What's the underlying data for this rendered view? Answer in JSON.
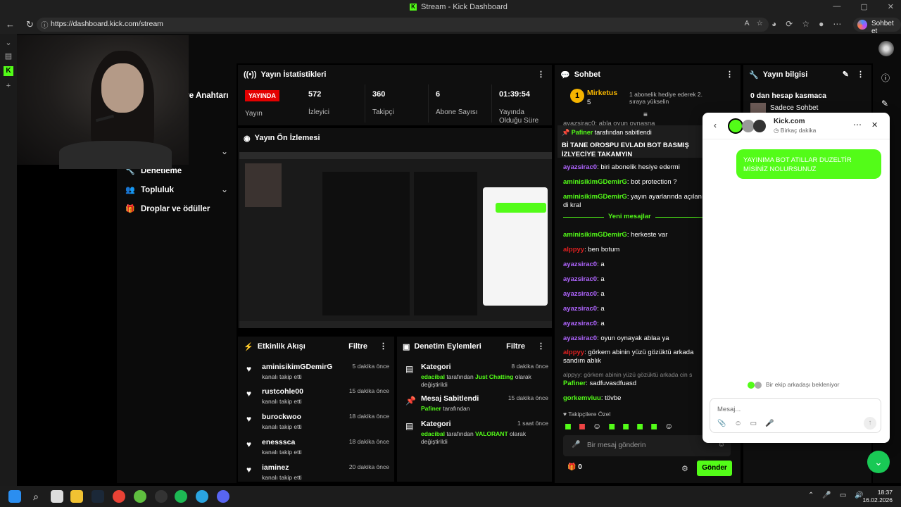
{
  "browser": {
    "title": "Stream - Kick Dashboard",
    "url": "https://dashboard.kick.com/stream",
    "copilot_label": "Sohbet et"
  },
  "nav": {
    "partial_label": "ı ve Anahtarı",
    "moderation": "Denetleme",
    "community": "Topluluk",
    "drops": "Droplar ve ödüller"
  },
  "stats": {
    "header": "Yayın İstatistikleri",
    "live_badge": "YAYINDA",
    "live_label": "Yayın",
    "viewers_value": "572",
    "viewers_label": "İzleyici",
    "followers_value": "360",
    "followers_label": "Takipçi",
    "subs_value": "6",
    "subs_label": "Abone Sayısı",
    "duration_value": "01:39:54",
    "duration_label": "Yayında Olduğu Süre"
  },
  "preview": {
    "header": "Yayın Ön İzlemesi"
  },
  "activity": {
    "header": "Etkinlik Akışı",
    "filter": "Filtre",
    "items": [
      {
        "name": "aminisikimGDemirG",
        "sub": "kanalı takip etti",
        "time": "5 dakika önce"
      },
      {
        "name": "rustcohle00",
        "sub": "kanalı takip etti",
        "time": "15 dakika önce"
      },
      {
        "name": "burockwoo",
        "sub": "kanalı takip etti",
        "time": "18 dakika önce"
      },
      {
        "name": "enesssca",
        "sub": "kanalı takip etti",
        "time": "18 dakika önce"
      },
      {
        "name": "iaminez",
        "sub": "kanalı takip etti",
        "time": "20 dakika önce"
      }
    ]
  },
  "moderation": {
    "header": "Denetim Eylemleri",
    "filter": "Filtre",
    "items": [
      {
        "title": "Kategori",
        "time": "8 dakika önce",
        "user": "edacibal",
        "mid": " tarafından ",
        "target": "Just Chatting",
        "end": " olarak değiştirildi"
      },
      {
        "title": "Mesaj Sabitlendi",
        "time": "15 dakika önce",
        "user": "Pafiner",
        "mid": " tarafından",
        "target": "",
        "end": ""
      },
      {
        "title": "Kategori",
        "time": "1 saat önce",
        "user": "edacibal",
        "mid": " tarafından ",
        "target": "VALORANT",
        "end": " olarak değiştirildi"
      }
    ]
  },
  "chat": {
    "header": "Sohbet",
    "gifter_name": "Mirketus",
    "gifter_count": "5",
    "gifter_text": "1 abonelik hediye ederek 2. sıraya yükselin",
    "partial_top": "ayazsirac0: abla oyun oynasna",
    "pinned_by": "Pafiner",
    "pinned_by_text": " tarafından sabitlendi",
    "pinned_text": "Bİ TANE OROSPU EVLADI BOT BASMIŞ İZLYECİYE TAKAMYIN",
    "new_messages": "Yeni mesajlar",
    "messages": [
      {
        "user": "ayazsirac0",
        "text": "biri abonelik hesiye edermi",
        "color": "#b065ff"
      },
      {
        "user": "aminisikimGDemirG",
        "text": "bot protection ?",
        "color": "#53fc18"
      },
      {
        "user": "aminisikimGDemirG",
        "text": "yayın ayarlarında açılanı di kral",
        "color": "#53fc18"
      },
      {
        "user": "aminisikimGDemirG",
        "text": "herkeste var",
        "color": "#53fc18"
      },
      {
        "user": "alppyy",
        "text": "ben botum",
        "color": "#e02020"
      },
      {
        "user": "ayazsirac0",
        "text": "a",
        "color": "#b065ff"
      },
      {
        "user": "ayazsirac0",
        "text": "a",
        "color": "#b065ff"
      },
      {
        "user": "ayazsirac0",
        "text": "a",
        "color": "#b065ff"
      },
      {
        "user": "ayazsirac0",
        "text": "a",
        "color": "#b065ff"
      },
      {
        "user": "ayazsirac0",
        "text": "a",
        "color": "#b065ff"
      },
      {
        "user": "ayazsirac0",
        "text": "oyun oynayak ablaa ya",
        "color": "#b065ff"
      },
      {
        "user": "alppyy",
        "text": "görkem abinin yüzü gözüktü arkada sandım ablık",
        "color": "#e02020"
      }
    ],
    "reply_hint": "alppyy: görkem abinin yüzü gözüktü arkada cin s",
    "messages2": [
      {
        "user": "Pafiner",
        "text": "sadfuvasdfuasd",
        "color": "#53fc18"
      },
      {
        "user": "gorkemviuu",
        "text": "tövbe",
        "color": "#53fc18"
      }
    ],
    "followers_special": "Takipçilere Özel",
    "input_placeholder": "Bir mesaj gönderin",
    "points": "0",
    "send": "Gönder"
  },
  "info": {
    "header": "Yayın bilgisi",
    "title": "0 dan hesap kasmaca",
    "mode": "Sadece Sohbet"
  },
  "popup": {
    "site": "Kick.com",
    "status": "Birkaç dakika",
    "message": "YAYINIMA BOT ATILLAR DUZELTİR MİSİNİZ NOLURSUNUZ",
    "waiting": "Bir ekip arkadaşı bekleniyor",
    "placeholder": "Mesaj..."
  },
  "taskbar": {
    "time": "18:37",
    "date": "16.02.2026"
  }
}
